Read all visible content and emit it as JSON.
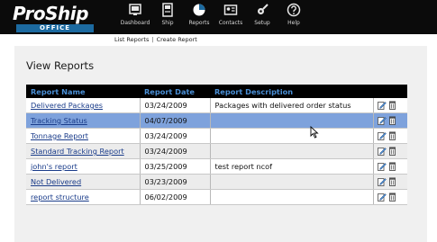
{
  "app": {
    "logo_main": "ProShip",
    "logo_sub": "OFFICE"
  },
  "nav": [
    {
      "label": "Dashboard",
      "icon": "dashboard-icon"
    },
    {
      "label": "Ship",
      "icon": "ship-icon"
    },
    {
      "label": "Reports",
      "icon": "reports-icon"
    },
    {
      "label": "Contacts",
      "icon": "contacts-icon"
    },
    {
      "label": "Setup",
      "icon": "setup-icon"
    },
    {
      "label": "Help",
      "icon": "help-icon"
    }
  ],
  "subnav": {
    "list_reports": "List Reports",
    "separator": "|",
    "create_report": "Create Report"
  },
  "page": {
    "title": "View Reports"
  },
  "table": {
    "headers": [
      "Report Name",
      "Report Date",
      "Report Description",
      ""
    ],
    "rows": [
      {
        "name": "Delivered Packages",
        "date": "03/24/2009",
        "description": "Packages with delivered order status"
      },
      {
        "name": "Tracking Status",
        "date": "04/07/2009",
        "description": "",
        "selected": true
      },
      {
        "name": "Tonnage Report",
        "date": "03/24/2009",
        "description": ""
      },
      {
        "name": "Standard Tracking Report",
        "date": "03/24/2009",
        "description": ""
      },
      {
        "name": "john's report",
        "date": "03/25/2009",
        "description": "test report ncof"
      },
      {
        "name": "Not Delivered",
        "date": "03/23/2009",
        "description": ""
      },
      {
        "name": "report structure",
        "date": "06/02/2009",
        "description": ""
      }
    ],
    "action_icons": [
      "edit-icon",
      "delete-icon"
    ]
  },
  "colors": {
    "header_bg": "#0b0b0b",
    "table_header_text": "#4a8fd6",
    "selected_row": "#7ea2dc",
    "link": "#1a3c8a",
    "logo_office_bg": "#1c6aa0"
  }
}
